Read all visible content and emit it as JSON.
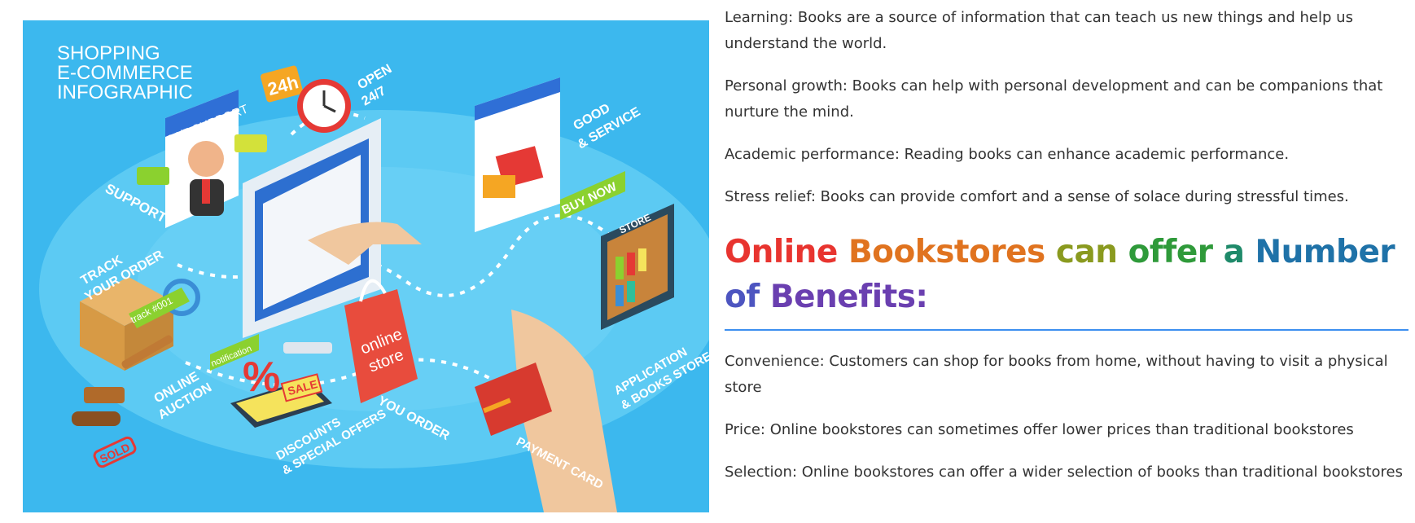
{
  "infographic": {
    "title_lines": [
      "SHOPPING",
      "E-COMMERCE",
      "INFOGRAPHIC"
    ],
    "labels": {
      "support_banner": "24/7 SUPPORT",
      "clock_badge": "24h",
      "open": "OPEN",
      "open_hours": "24/7",
      "good_service": "GOOD",
      "good_service_2": "& SERVICE",
      "buy_now": "BUY NOW",
      "store_sign": "STORE",
      "support": "SUPPORT",
      "track_order": "TRACK",
      "track_order_2": "YOUR ORDER",
      "track_tag": "track #001",
      "online_auction": "ONLINE",
      "online_auction_2": "AUCTION",
      "sold": "SOLD",
      "notification": "notification",
      "sale": "SALE",
      "discounts": "DISCOUNTS",
      "discounts_2": "& SPECIAL OFFERS",
      "online_store_bag": "online",
      "online_store_bag_2": "store",
      "you_order": "YOU ORDER",
      "payment_card": "PAYMENT CARD",
      "application": "APPLICATION",
      "application_2": "& BOOKS STORE"
    },
    "colors": {
      "background": "#3cb8ee",
      "floor": "#5ccaf3",
      "accent_orange": "#f5a623",
      "accent_green": "#8bd12f",
      "accent_red": "#e53935"
    }
  },
  "content": {
    "paragraphs_top": [
      "Learning: Books are a source of information that can teach us new things and help us understand the world.",
      "Personal growth: Books can help with personal development and can be companions that nurture the mind.",
      "Academic performance: Reading books can enhance academic performance.",
      "Stress relief: Books can provide comfort and a sense of solace during stressful times."
    ],
    "heading_words": [
      {
        "text": "Online ",
        "color": "#e8342f"
      },
      {
        "text": "Bookstores ",
        "color": "#e0731f"
      },
      {
        "text": "can ",
        "color": "#8a9a1f"
      },
      {
        "text": "offer ",
        "color": "#2f9a3a"
      },
      {
        "text": "a ",
        "color": "#1f8a6a"
      },
      {
        "text": "Number ",
        "color": "#1f72a8"
      },
      {
        "text": "of ",
        "color": "#4d55c0"
      },
      {
        "text": "Benefits:",
        "color": "#6a3fb0"
      }
    ],
    "paragraphs_bottom": [
      "Convenience: Customers can shop for books from home, without having to visit a physical store",
      "Price: Online bookstores can sometimes offer lower prices than traditional bookstores",
      "Selection: Online bookstores can offer a wider selection of books than traditional bookstores"
    ]
  }
}
